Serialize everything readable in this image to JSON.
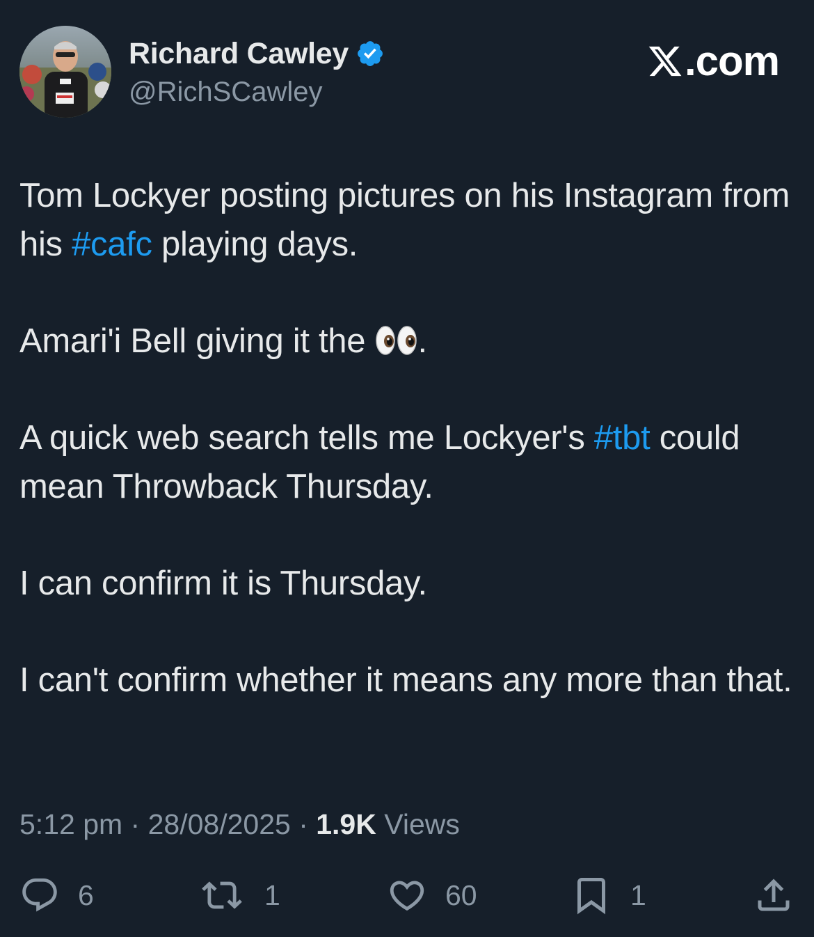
{
  "author": {
    "display_name": "Richard Cawley",
    "handle": "@RichSCawley",
    "verified": true,
    "verified_icon": "verified-badge-icon"
  },
  "brand": {
    "label": ".com",
    "logo_icon": "x-logo-icon"
  },
  "tweet": {
    "p1_a": "Tom Lockyer posting pictures on his Instagram from his ",
    "p1_tag": "#cafc",
    "p1_b": " playing days.",
    "p2_a": "Amari'i Bell giving it the ",
    "p2_emoji": "eyes-emoji",
    "p2_b": ".",
    "p3_a": "A quick web search tells me Lockyer's ",
    "p3_tag": "#tbt",
    "p3_b": " could mean Throwback Thursday.",
    "p4": "I can confirm it is Thursday.",
    "p5": "I can't confirm whether it means any more than that."
  },
  "meta": {
    "time": "5:12 pm",
    "separator": " · ",
    "date": "28/08/2025",
    "views_count": "1.9K",
    "views_label": " Views"
  },
  "actions": {
    "replies": "6",
    "reposts": "1",
    "likes": "60",
    "bookmarks": "1"
  },
  "colors": {
    "background": "#161f2a",
    "text": "#e7e9ea",
    "secondary": "#8b98a5",
    "accent": "#1d9bf0"
  }
}
